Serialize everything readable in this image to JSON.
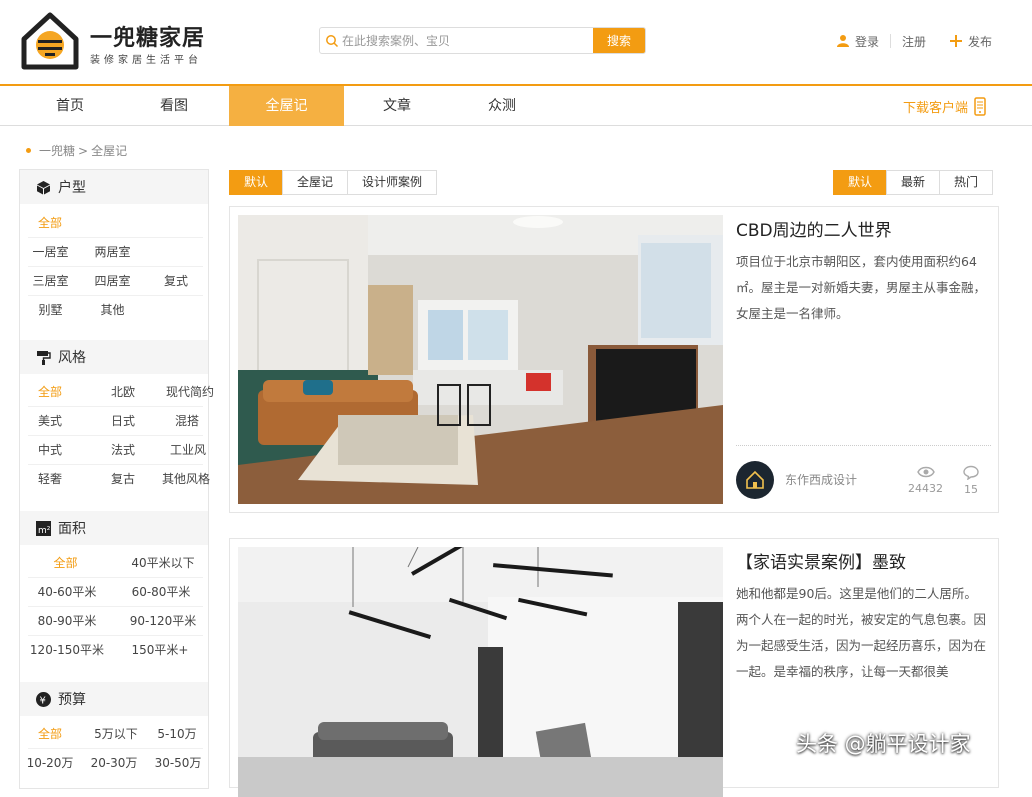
{
  "brand": {
    "name": "一兜糖家居",
    "slogan": "装修家居生活平台"
  },
  "search": {
    "placeholder": "在此搜索案例、宝贝",
    "button": "搜索"
  },
  "user_links": {
    "login": "登录",
    "register": "注册",
    "publish": "发布"
  },
  "nav": {
    "items": [
      "首页",
      "看图",
      "全屋记",
      "文章",
      "众测"
    ],
    "active": "全屋记",
    "download": "下载客户端"
  },
  "breadcrumb": {
    "home": "一兜糖",
    "separator": ">",
    "current": "全屋记"
  },
  "sidebar": {
    "house_type": {
      "title": "户型",
      "options": [
        "全部",
        "一居室",
        "两居室",
        "三居室",
        "四居室",
        "复式",
        "别墅",
        "其他"
      ],
      "active": "全部"
    },
    "style": {
      "title": "风格",
      "options": [
        "全部",
        "北欧",
        "现代简约",
        "美式",
        "日式",
        "混搭",
        "中式",
        "法式",
        "工业风",
        "轻奢",
        "复古",
        "其他风格"
      ],
      "active": "全部"
    },
    "area": {
      "title": "面积",
      "options": [
        "全部",
        "40平米以下",
        "40-60平米",
        "60-80平米",
        "80-90平米",
        "90-120平米",
        "120-150平米",
        "150平米+"
      ],
      "active": "全部"
    },
    "budget": {
      "title": "预算",
      "options": [
        "全部",
        "5万以下",
        "5-10万",
        "10-20万",
        "20-30万",
        "30-50万"
      ],
      "active": "全部"
    }
  },
  "filter_tabs": {
    "items": [
      "默认",
      "全屋记",
      "设计师案例"
    ],
    "active": "默认"
  },
  "sort_tabs": {
    "items": [
      "默认",
      "最新",
      "热门"
    ],
    "active": "默认"
  },
  "cases": [
    {
      "title": "CBD周边的二人世界",
      "description": "项目位于北京市朝阳区，套内使用面积约64㎡。屋主是一对新婚夫妻，男屋主从事金融，女屋主是一名律师。",
      "author": "东作西成设计",
      "views": "24432",
      "comments": "15"
    },
    {
      "title": "【家语实景案例】墨致",
      "description": "她和他都是90后。这里是他们的二人居所。两个人在一起的时光，被安定的气息包裹。因为一起感受生活，因为一起经历喜乐，因为在一起。是幸福的秩序，让每一天都很美"
    }
  ],
  "watermark": "头条 @躺平设计家",
  "colors": {
    "accent": "#f39c12",
    "nav_active": "#f5b041"
  }
}
